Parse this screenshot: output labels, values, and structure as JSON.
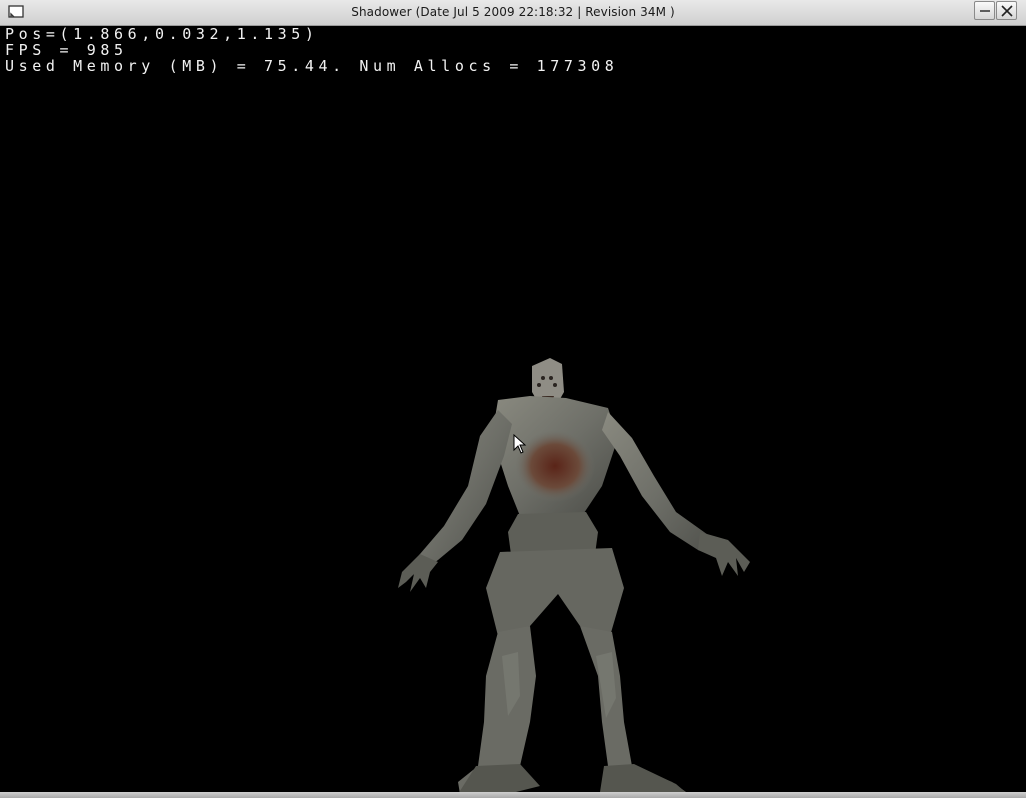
{
  "window": {
    "title": "Shadower  (Date Jul  5 2009 22:18:32 | Revision 34M )"
  },
  "hud": {
    "pos_line": "Pos=(1.866,0.032,1.135)",
    "fps_line": "FPS = 985",
    "memory_line": "Used Memory (MB) = 75.44. Num Allocs = 177308"
  },
  "icons": {
    "window_icon": "window-icon",
    "minimize": "minimize-icon",
    "close": "close-icon",
    "cursor": "mouse-cursor-icon"
  },
  "colors": {
    "background": "#000000",
    "hud_text": "#f2f2f2",
    "titlebar": "#dcdcdc"
  }
}
